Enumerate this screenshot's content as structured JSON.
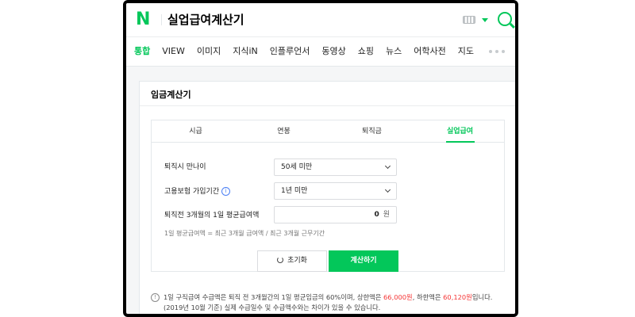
{
  "header": {
    "logo": "N",
    "query": "실업급여계산기"
  },
  "nav": {
    "items": [
      "통합",
      "VIEW",
      "이미지",
      "지식iN",
      "인플루언서",
      "동영상",
      "쇼핑",
      "뉴스",
      "어학사전",
      "지도"
    ],
    "active_index": 0
  },
  "card": {
    "title": "임금계산기",
    "tabs": [
      "시급",
      "연봉",
      "퇴직금",
      "실업급여"
    ],
    "active_tab": 3,
    "age_label": "퇴직시 만나이",
    "age_value": "50세 미만",
    "insurance_label": "고용보험 가입기간",
    "insurance_info": "i",
    "insurance_value": "1년 미만",
    "avg_wage_label": "퇴직전 3개월의 1일 평균급여액",
    "avg_wage_value": "0",
    "avg_wage_unit": "원",
    "formula": "1일 평균급여액 = 최근 3개월 급여액 / 최근 3개월 근무기간",
    "reset_label": "초기화",
    "calc_label": "계산하기"
  },
  "notice": {
    "icon": "!",
    "part1": "1일 구직급여 수급액은 퇴직 전 3개월간의 1일 평균임금의 60%이며, 상한액은 ",
    "upper_limit": "66,000원",
    "part2": ", 하한액은 ",
    "lower_limit": "60,120원",
    "part3": "입니다.",
    "line2": "(2019년 10월 기준) 실제 수급일수 및 수급액수와는 차이가 있을 수 있습니다."
  },
  "colors": {
    "brand": "#03c75a",
    "highlight": "#f53535",
    "info": "#4a7ff5"
  }
}
